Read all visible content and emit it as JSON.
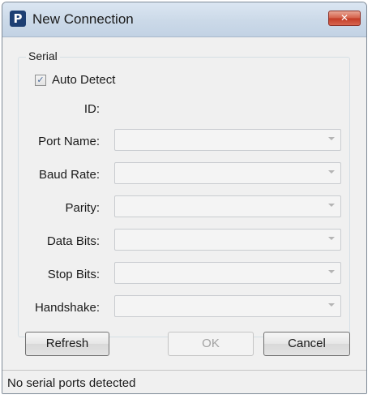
{
  "window": {
    "title": "New Connection",
    "app_icon_letter": "P",
    "close_glyph": "✕"
  },
  "serial_group": {
    "legend": "Serial",
    "auto_detect": {
      "label": "Auto Detect",
      "checked": true,
      "check_glyph": "✓"
    },
    "id_label": "ID:",
    "fields": [
      {
        "label": "Port Name:",
        "value": ""
      },
      {
        "label": "Baud Rate:",
        "value": ""
      },
      {
        "label": "Parity:",
        "value": ""
      },
      {
        "label": "Data Bits:",
        "value": ""
      },
      {
        "label": "Stop Bits:",
        "value": ""
      },
      {
        "label": "Handshake:",
        "value": ""
      }
    ]
  },
  "buttons": {
    "refresh": "Refresh",
    "ok": "OK",
    "cancel": "Cancel"
  },
  "status": {
    "text": "No serial ports detected"
  },
  "icons": {
    "app": "app-logo-icon",
    "close": "close-icon",
    "dropdown": "chevron-down-icon"
  }
}
